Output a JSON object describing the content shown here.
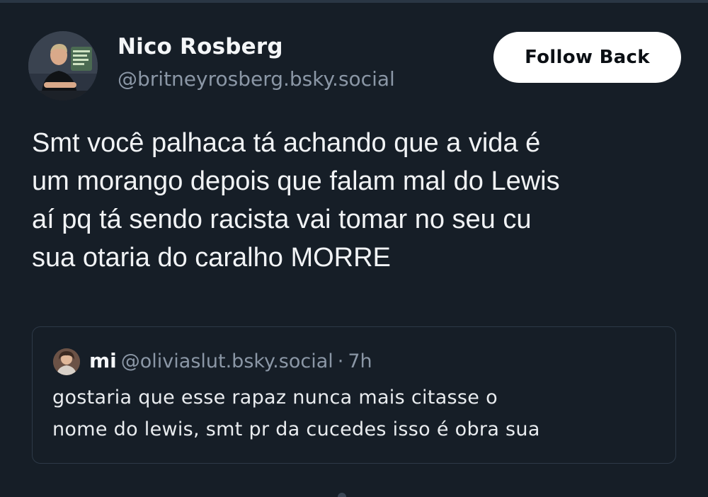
{
  "post": {
    "author": {
      "display_name": "Nico Rosberg",
      "handle": "@britneyrosberg.bsky.social",
      "avatar_icon": "profile-photo"
    },
    "follow_button_label": "Follow Back",
    "text_lines": [
      "Smt você palhaca tá achando que  a vida é",
      "um morango depois que falam mal do Lewis",
      "aí pq tá sendo racista vai tomar no seu cu",
      "sua otaria do caralho MORRE"
    ]
  },
  "quoted_post": {
    "author": {
      "display_name": "mi",
      "handle": "@oliviaslut.bsky.social",
      "avatar_icon": "profile-photo"
    },
    "separator": "·",
    "time": "7h",
    "text_lines": [
      "gostaria que esse rapaz nunca mais citasse o",
      "nome do lewis, smt pr da cucedes isso é obra sua"
    ]
  },
  "theme": {
    "background": "#161e27",
    "text": "#f1f3f5",
    "muted": "#8b97a6",
    "button_bg": "#ffffff",
    "border": "#2d3947"
  }
}
